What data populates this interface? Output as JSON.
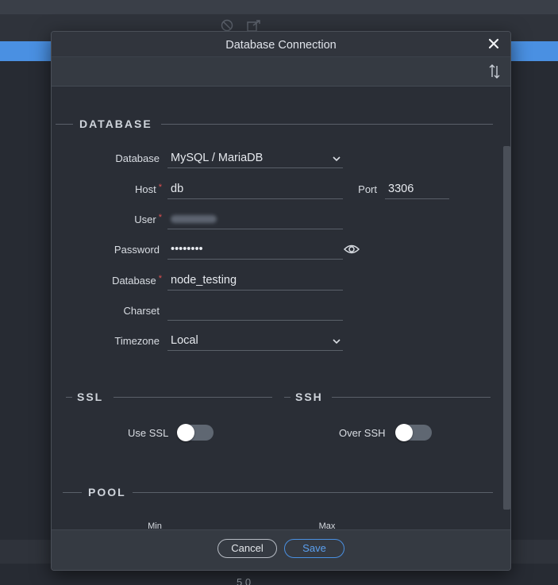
{
  "dialog": {
    "title": "Database Connection"
  },
  "sections": {
    "database": "DATABASE",
    "ssl": "SSL",
    "ssh": "SSH",
    "pool": "POOL"
  },
  "fields": {
    "database_type": {
      "label": "Database",
      "value": "MySQL / MariaDB"
    },
    "host": {
      "label": "Host",
      "value": "db",
      "required": true
    },
    "port": {
      "label": "Port",
      "value": "3306"
    },
    "user": {
      "label": "User",
      "value": "",
      "required": true
    },
    "password": {
      "label": "Password",
      "value": "••••••••"
    },
    "database_name": {
      "label": "Database",
      "value": "node_testing",
      "required": true
    },
    "charset": {
      "label": "Charset",
      "value": ""
    },
    "timezone": {
      "label": "Timezone",
      "value": "Local"
    }
  },
  "toggles": {
    "use_ssl": {
      "label": "Use SSL",
      "on": false
    },
    "over_ssh": {
      "label": "Over SSH",
      "on": false
    }
  },
  "pool": {
    "min_label": "Min",
    "max_label": "Max"
  },
  "footer": {
    "cancel": "Cancel",
    "save": "Save"
  },
  "background": {
    "footer_text": "5 0"
  },
  "colors": {
    "accent": "#4a90e2",
    "required": "#e05050",
    "dialog_bg": "#2a2e36"
  },
  "icons": {
    "close": "close-icon",
    "sort": "sort-arrows-icon",
    "chevron": "chevron-down-icon",
    "eye": "eye-icon"
  }
}
